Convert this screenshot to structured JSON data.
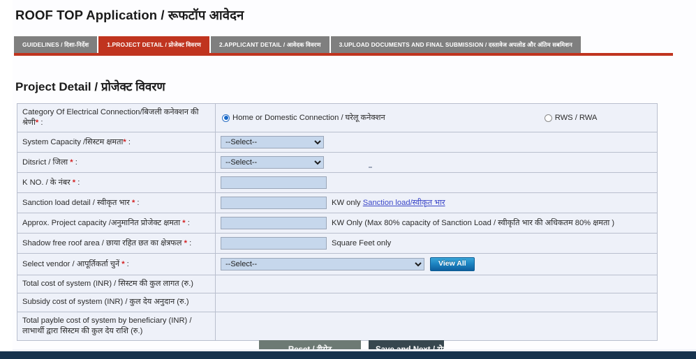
{
  "header": {
    "title": "ROOF TOP Application / रूफटॉप आवेदन"
  },
  "tabs": [
    {
      "label": "GUIDELINES / दिशा-निर्देश",
      "active": false
    },
    {
      "label": "1.PROJECT DETAIL / प्रोजेक्ट विवरण",
      "active": true
    },
    {
      "label": "2.APPLICANT DETAIL / आवेदक विवरण",
      "active": false
    },
    {
      "label": "3.UPLOAD DOCUMENTS AND FINAL SUBMISSION / दस्तावेज अपलोड और अंतिम सबमिशन",
      "active": false
    }
  ],
  "section": {
    "heading": "Project Detail / प्रोजेक्ट विवरण"
  },
  "form": {
    "category": {
      "label": "Category Of Electrical Connection/बिजली कनेक्शन की श्रेणी",
      "required_mark": "*",
      "colon": " :",
      "options": [
        {
          "label": "Home or Domestic Connection / घरेलू कनेक्शन",
          "selected": true
        },
        {
          "label": "RWS / RWA",
          "selected": false
        }
      ]
    },
    "system_capacity": {
      "label": "System Capacity /सिस्टम क्षमता",
      "required_mark": "*",
      "colon": " :",
      "value": "--Select--",
      "options": [
        "--Select--"
      ]
    },
    "district": {
      "label": "Ditsrict / जिला ",
      "required_mark": "*",
      "colon": " :",
      "value": "--Select--",
      "options": [
        "--Select--"
      ]
    },
    "k_no": {
      "label": "K NO. / के नंबर ",
      "required_mark": "*",
      "colon": " :",
      "value": "",
      "placeholder": ""
    },
    "sanction_load": {
      "label": "Sanction load detail / स्वीकृत भार ",
      "required_mark": "*",
      "colon": " :",
      "value": "",
      "unit_prefix": "KW only ",
      "link_text": "Sanction load/स्वीकृत भार"
    },
    "project_capacity": {
      "label": "Approx. Project capacity /अनुमानित प्रोजेक्ट क्षमता ",
      "required_mark": "*",
      "colon": " :",
      "value": "",
      "unit": "KW Only (Max 80% capacity of Sanction Load / स्वीकृति भार की अधिकतम 80% क्षमता )"
    },
    "roof_area": {
      "label": "Shadow free roof area / छाया रहित छत का क्षेत्रफल ",
      "required_mark": "*",
      "colon": " :",
      "value": "",
      "unit": "Square Feet only"
    },
    "vendor": {
      "label": "Select vendor / आपूर्तिकर्ता चुनें ",
      "required_mark": "*",
      "colon": " :",
      "value": "--Select--",
      "options": [
        "--Select--"
      ],
      "view_all_label": "View All"
    },
    "total_cost": {
      "label": "Total cost of system (INR) / सिस्टम की कुल लागत (रु.)",
      "value": ""
    },
    "subsidy_cost": {
      "label": "Subsidy cost of system (INR) / कुल देय अनुदान (रु.)",
      "value": ""
    },
    "payable_cost": {
      "label": "Total payble cost of system by beneficiary (INR) / लाभार्थी द्वारा सिस्टम की कुल देय राशि (रु.)",
      "value": ""
    }
  },
  "actions": {
    "reset_label": "Reset / रीसेट",
    "save_label": "Save and Next / सेव"
  },
  "colors": {
    "accent_red": "#c0341f",
    "tab_inactive": "#7f7f7f",
    "row_bg": "#eef1f9",
    "input_bg": "#c6d7ec",
    "link": "#3a46c8",
    "required": "#d32020",
    "footer": "#17334d"
  }
}
